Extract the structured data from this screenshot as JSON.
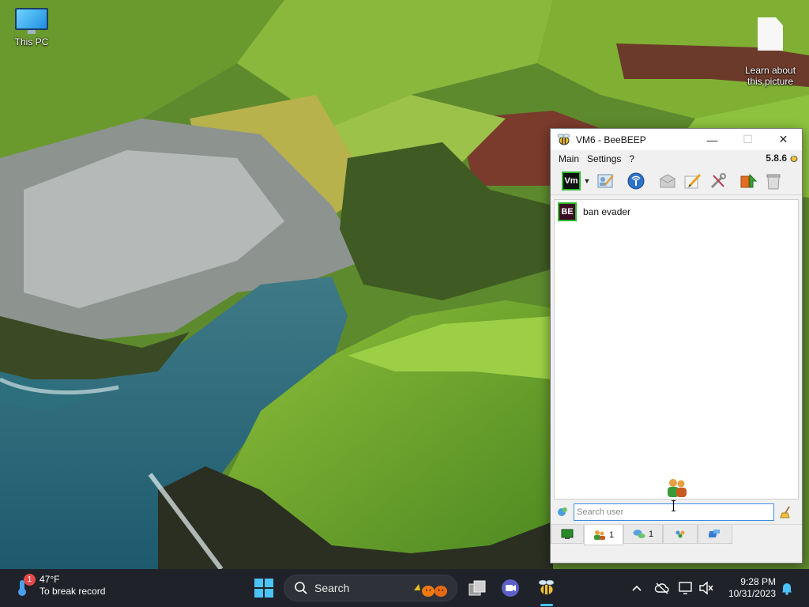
{
  "desktop": {
    "icons": [
      {
        "label": "This PC",
        "icon": "computer-icon"
      },
      {
        "label": "Learn about\nthis picture",
        "icon": "document-icon"
      }
    ]
  },
  "window": {
    "title": "VM6 - BeeBEEP",
    "menu": [
      "Main",
      "Settings",
      "?"
    ],
    "version": "5.8.6",
    "toolbar": {
      "status_badge": "Vm",
      "icons": [
        "status-icon",
        "profile-edit-icon",
        "network-icon",
        "message-icon",
        "pen-icon",
        "tools-icon",
        "update-icon",
        "trash-icon"
      ]
    },
    "users": [
      {
        "initials": "BE",
        "name": "ban evader"
      }
    ],
    "search": {
      "placeholder": "Search user",
      "value": ""
    },
    "tabs": [
      {
        "icon": "monitor-icon",
        "count": ""
      },
      {
        "icon": "users-icon",
        "count": "1"
      },
      {
        "icon": "chat-icon",
        "count": "1"
      },
      {
        "icon": "groups-icon",
        "count": ""
      },
      {
        "icon": "share-icon",
        "count": ""
      }
    ],
    "active_tab": 1
  },
  "taskbar": {
    "weather": {
      "badge": "1",
      "temp": "47°F",
      "caption": "To break record"
    },
    "search_label": "Search",
    "clock": {
      "time": "9:28 PM",
      "date": "10/31/2023"
    }
  },
  "colors": {
    "taskbar_bg": "#1f2228",
    "accent": "#4cc2ff",
    "status_green": "#2db82d",
    "search_border": "#3a8ee6",
    "avatar_bg": "#3a0d25"
  }
}
